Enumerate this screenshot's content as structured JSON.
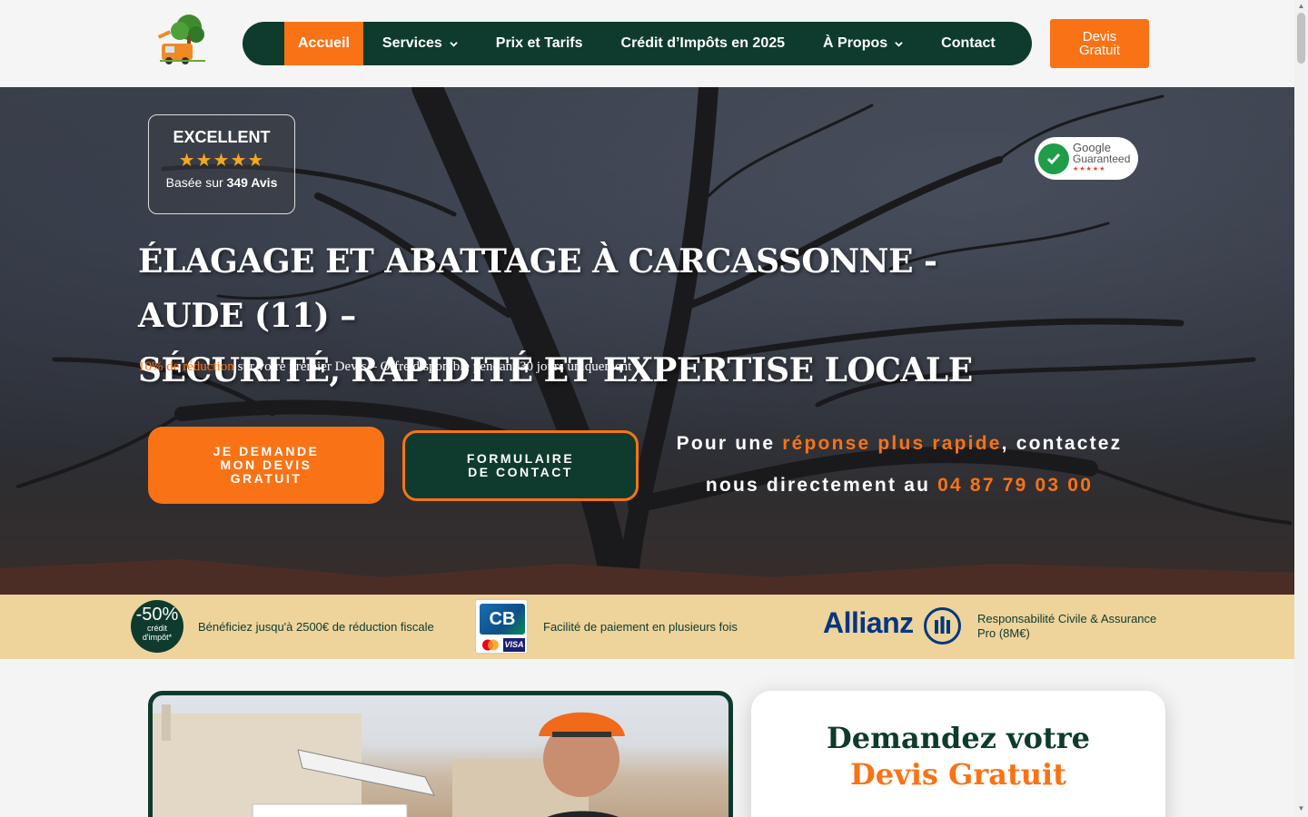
{
  "header": {
    "logo_icon": "tree-truck-logo-icon",
    "nav": [
      {
        "label": "Accueil",
        "active": true,
        "dropdown": false
      },
      {
        "label": "Services",
        "active": false,
        "dropdown": true
      },
      {
        "label": "Prix et Tarifs",
        "active": false,
        "dropdown": false
      },
      {
        "label": "Crédit d’Impôts en 2025",
        "active": false,
        "dropdown": false
      },
      {
        "label": "À Propos",
        "active": false,
        "dropdown": true
      },
      {
        "label": "Contact",
        "active": false,
        "dropdown": false
      }
    ],
    "devis_button": "Devis Gratuit"
  },
  "hero": {
    "review": {
      "title": "EXCELLENT",
      "stars": "★★★★★",
      "rating_stars": 5,
      "based_on": "Basée sur",
      "count": "349 Avis"
    },
    "google_badge": {
      "line1": "Google",
      "line2": "Guaranteed",
      "stars": "★★★★★"
    },
    "title_line1": "ÉLAGAGE ET ABATTAGE À CARCASSONNE - AUDE (11) –",
    "title_line2": "SÉCURITÉ, RAPIDITÉ ET EXPERTISE LOCALE",
    "promo_highlight": "10% de réduction",
    "promo_rest": " sur votre premier Devis – Offre disponible pendant 30 jours uniquement !",
    "cta_primary": "JE DEMANDE MON DEVIS GRATUIT",
    "cta_secondary": "FORMULAIRE DE CONTACT",
    "contact": {
      "part1": "Pour une ",
      "highlight": "réponse plus rapide",
      "part2": ", contactez nous directement au ",
      "phone": "04 87 79 03 00"
    }
  },
  "strip": {
    "badge_percent": "-50%",
    "badge_line1": "crédit",
    "badge_line2": "d'impôt*",
    "tax_text": "Bénéficiez jusqu'à 2500€ de réduction fiscale",
    "cb_label": "CB",
    "visa_label": "VISA",
    "payment_text": "Facilité de paiement en plusieurs fois",
    "allianz_label": "Allianz",
    "insurance_text_1": "Responsabilité Civile & Assurance",
    "insurance_text_2": "Pro (8M€)"
  },
  "form_card": {
    "title_line1": "Demandez votre",
    "title_line2": "Devis Gratuit"
  },
  "colors": {
    "primary_green": "#0e3b2d",
    "accent_orange": "#f97316",
    "strip_beige": "#eed39b"
  }
}
